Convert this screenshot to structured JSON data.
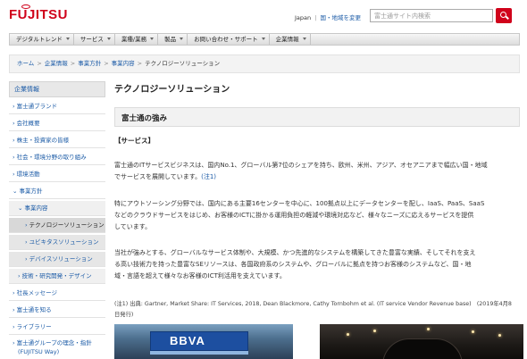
{
  "header": {
    "logo": "FUJITSU",
    "region_label": "Japan",
    "region_link": "国・地域を変更",
    "search_placeholder": "富士通サイト内検索"
  },
  "global_nav": [
    "デジタルトレンド",
    "サービス",
    "業種/業務",
    "製品",
    "お問い合わせ・サポート",
    "企業情報"
  ],
  "breadcrumb": [
    "ホーム",
    "企業情報",
    "事業方針",
    "事業内容",
    "テクノロジーソリューション"
  ],
  "sidebar": {
    "heading": "企業情報",
    "items": [
      {
        "label": "富士通ブランド"
      },
      {
        "label": "会社概要"
      },
      {
        "label": "株主・投資家の皆様"
      },
      {
        "label": "社会・環境分野の取り組み"
      },
      {
        "label": "環境活動"
      },
      {
        "label": "事業方針"
      },
      {
        "label": "事業内容"
      },
      {
        "label": "テクノロジーソリューション"
      },
      {
        "label": "ユビキタスソリューション"
      },
      {
        "label": "デバイスソリューション"
      },
      {
        "label": "技術・研究開発・デザイン"
      },
      {
        "label": "社長メッセージ"
      },
      {
        "label": "富士通を知る"
      },
      {
        "label": "ライブラリー"
      },
      {
        "label": "富士通グループの理念・指針"
      },
      {
        "label": "(FUJITSU Way)"
      }
    ]
  },
  "main": {
    "title": "テクノロジーソリューション",
    "section_title": "富士通の強み",
    "subheading": "【サービス】",
    "para1_line1": "富士通のITサービスビジネスは、国内No.1、グローバル第7位のシェアを持ち、欧州、米州、アジア、オセアニアまで幅広い国・地域",
    "para1_line2": "でサービスを展開しています。",
    "para1_note_link": "(注1)",
    "para2_line1": "特にアウトソーシング分野では、国内にある主要16センターを中心に、100拠点以上にデータセンターを配し、IaaS、PaaS、SaaS",
    "para2_line2": "などのクラウドサービスをはじめ、お客様のICTに掛かる運用負担の軽減や環境対応など、様々なニーズに応えるサービスを提供",
    "para2_line3": "しています。",
    "para3_line1": "当社が強みとする、グローバルなサービス体制や、大規模、かつ先進的なシステムを構築してきた豊富な実績、そしてそれを支え",
    "para3_line2": "る高い技術力を持った豊富なSEリソースは、各国政府系のシステムや、グローバルに拠点を持つお客様のシステムなど、国・地",
    "para3_line3": "域・言語を超えて様々なお客様のICT利活用を支えています。",
    "note_line1": "(注1) 出典: Gartner, Market Share: IT Services, 2018, Dean Blackmore, Cathy Tornbohm et al. (IT service Vendor Revenue base)　(2019年4月8",
    "note_line2": "日発行)",
    "photo1_sign": "BBVA"
  }
}
